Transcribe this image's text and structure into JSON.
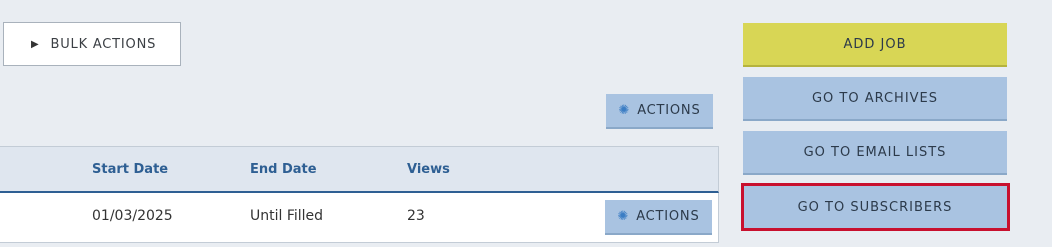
{
  "toolbar": {
    "bulk_actions_label": "BULK ACTIONS",
    "actions_label": "ACTIONS"
  },
  "side_buttons": {
    "add_job": "ADD JOB",
    "archives": "GO TO ARCHIVES",
    "email_lists": "GO TO EMAIL LISTS",
    "subscribers": "GO TO SUBSCRIBERS"
  },
  "table": {
    "headers": [
      "Start Date",
      "End Date",
      "Views"
    ],
    "rows": [
      {
        "start_date": "01/03/2025",
        "end_date": "Until Filled",
        "views": "23",
        "actions_label": "ACTIONS"
      }
    ]
  },
  "icons": {
    "bulk_toggle": "play-triangle-icon",
    "actions": "gear-icon"
  },
  "colors": {
    "accent_yellow": "#d8d655",
    "accent_blue": "#a9c3e1",
    "header_text": "#2e5f93",
    "highlight_border": "#c8102e"
  }
}
